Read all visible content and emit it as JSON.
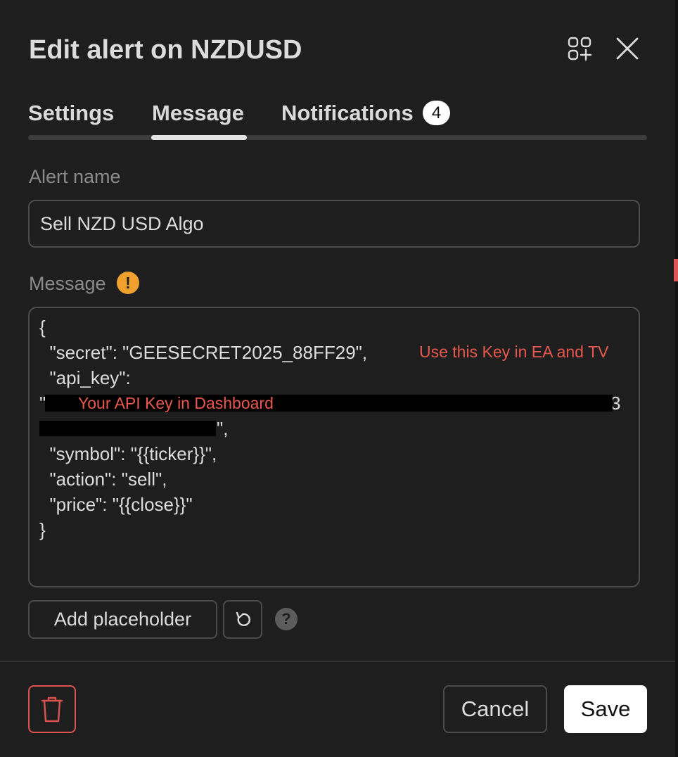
{
  "dialog": {
    "title": "Edit alert on NZDUSD",
    "icons": {
      "layout": "grid-plus-icon",
      "close": "close-icon"
    }
  },
  "tabs": [
    {
      "label": "Settings",
      "active": false
    },
    {
      "label": "Message",
      "active": true
    },
    {
      "label": "Notifications",
      "active": false,
      "badge": "4"
    }
  ],
  "form": {
    "alert_name_label": "Alert name",
    "alert_name_value": "Sell NZD USD Algo",
    "message_label": "Message",
    "message_warning_icon": "exclamation-icon",
    "message_lines": [
      "{",
      "  \"secret\": \"GEESECRET2025_88FF29\",",
      "  \"api_key\":",
      "\"",
      "3",
      "\",",
      "  \"symbol\": \"{{ticker}}\",",
      "  \"action\": \"sell\",",
      "  \"price\": \"{{close}}\"",
      "}"
    ],
    "annotations": {
      "secret_note": "Use this Key in EA and TV",
      "api_key_note": "Your API Key in Dashboard"
    }
  },
  "buttons": {
    "add_placeholder": "Add placeholder",
    "reset_icon": "reset-icon",
    "help_icon": "help-icon",
    "help_glyph": "?",
    "delete_icon": "trash-icon",
    "cancel": "Cancel",
    "save": "Save"
  },
  "colors": {
    "background": "#1e1e1e",
    "annotation": "#e8574e",
    "warning": "#f0a02c",
    "delete": "#d9544d"
  }
}
